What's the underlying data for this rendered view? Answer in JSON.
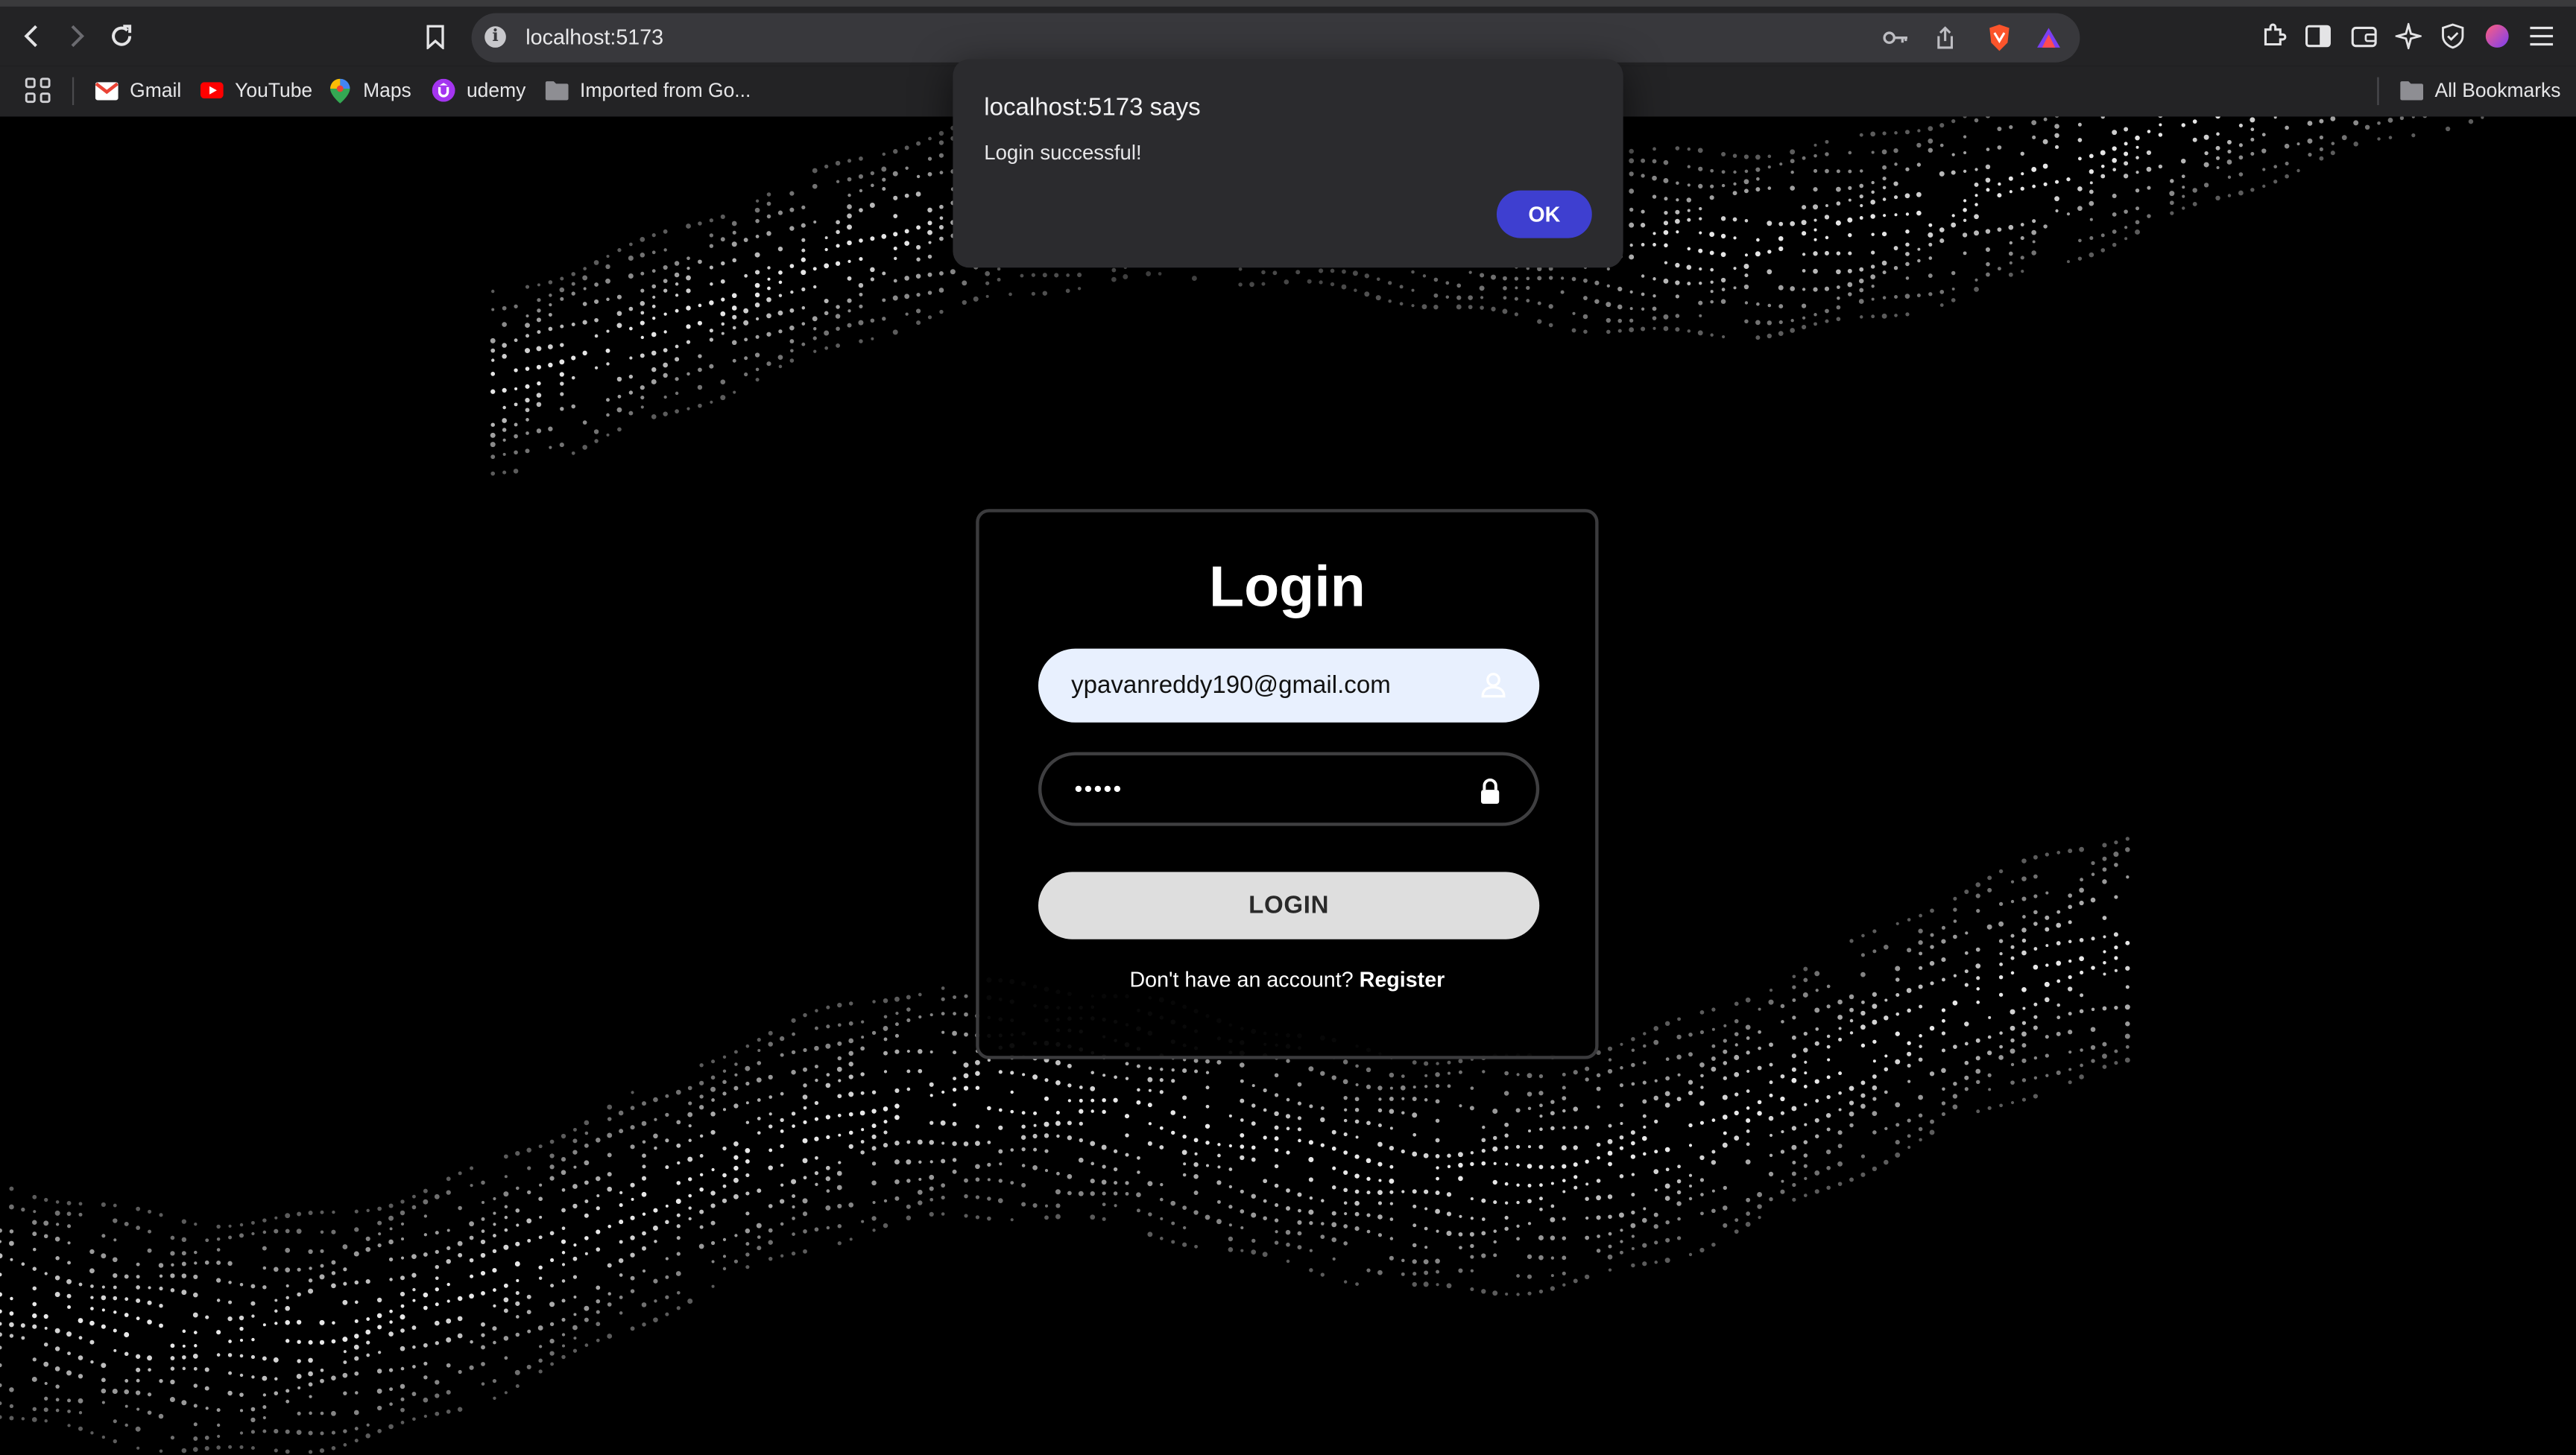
{
  "browser": {
    "url": "localhost:5173",
    "bookmarks": [
      {
        "label": "Gmail"
      },
      {
        "label": "YouTube"
      },
      {
        "label": "Maps"
      },
      {
        "label": "udemy"
      },
      {
        "label": "Imported from Go..."
      }
    ],
    "all_bookmarks_label": "All Bookmarks"
  },
  "login_form": {
    "title": "Login",
    "email_value": "ypavanreddy190@gmail.com",
    "password_masked": "•••••",
    "submit_label": "LOGIN",
    "register_prompt": "Don't have an account?",
    "register_link": "Register"
  },
  "alert": {
    "title": "localhost:5173 says",
    "message": "Login successful!",
    "ok_label": "OK",
    "ok_color": "#3e3fd0"
  }
}
